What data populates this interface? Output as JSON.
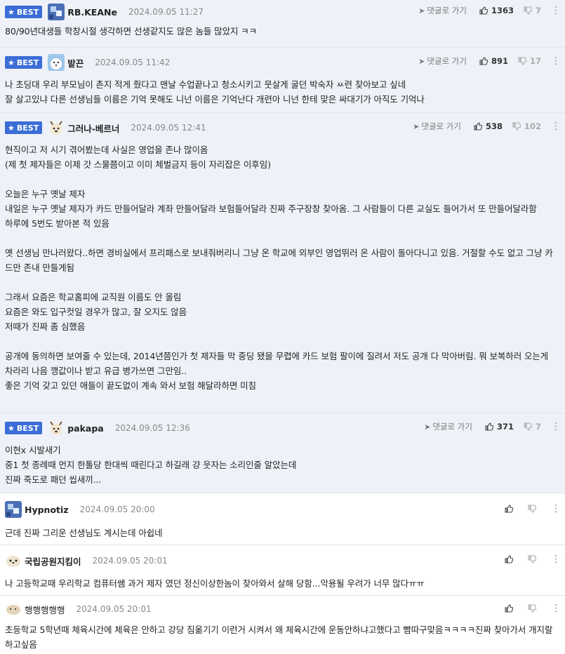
{
  "labels": {
    "best": "BEST",
    "reply": "댓글로 가기"
  },
  "colors": {
    "best_badge": "#3b6dd6",
    "best_row_bg": "#eef2f8"
  },
  "comments": [
    {
      "best": true,
      "nick": "RB.KEANe",
      "avatar": "blue-pixel-avatar",
      "date": "2024.09.05 11:27",
      "up": "1363",
      "down": "7",
      "body": "80/90년대생들 학창시절 생각하면 선생같지도 않은 놈들 많았지 ㅋㅋ"
    },
    {
      "best": true,
      "nick": "밭끈",
      "avatar": "white-bear-avatar",
      "date": "2024.09.05 11:42",
      "up": "891",
      "down": "17",
      "body": "나 초딩대 우리 부모님이 촌지 적게 줬다고 맨날 수업끝나고 청소시키고 뭇살게 굴던 박숙자 ㅆ련 찾아보고 싶네\n잘 살고있냐 다른 선생님들 이름은 기억 못해도 니넌 이름은 기억난다 개련아 니넌 한테 맞은 싸대기가 아직도 기억나"
    },
    {
      "best": true,
      "nick": "그러나-베르너",
      "avatar": "dog-avatar",
      "date": "2024.09.05 12:41",
      "up": "538",
      "down": "102",
      "body": "현직이고 저 시기 겪어봤는데 사실은 영업을 존나 많이옴\n(제 첫 제자들은 이제 갓 스물쯤이고 이미 체벌금지 등이 자리잡은 이후임)\n\n오늘은 누구 옛날 제자\n내일은 누구 옛날 제자가 카드 만들어달라 계좌 만들어달라 보험들어달라 진짜 주구장창 찾아옴. 그 사람들이 다른 교실도 들어가서 또 만들어달라함\n하루에 5번도 받아본 적 있음\n\n옛 선생님 만나러왔다..하면 경비실에서 프리패스로 보내줘버리니 그냥 온 학교에 외부인 영업뛰러 온 사람이 돌아다니고 있음. 거절할 수도 없고 그냥 카드만 존내 만들게됨\n\n그래서 요즘은 학교홈피에 교직원 이름도 안 올림\n요즘은 와도 입구컷일 경우가 많고, 잘 오지도 않음\n저때가 진짜 좀 심했음\n\n공개에 동의하면 보여줄 수 있는데, 2014년쯤인가 첫 제자들 막 중딩 됐을 무렵에 카드 보험 팔이에 질려서 저도 공개 다 막아버림. 뭐 보복하러 오는게 차라리 나음 깽값이나 받고 유급 병가쓰면 그만임..\n좋은 기억 갖고 있던 애들이 끝도없이 계속 와서 보험 해달라하면 미침"
    },
    {
      "best": true,
      "nick": "pakapa",
      "avatar": "dog-avatar",
      "date": "2024.09.05 12:36",
      "up": "371",
      "down": "7",
      "body": "이현x 시발새기\n중1 첫 종례때 먼지 한톨당 한대씩 때린다고 하길래 걍 웃자는 소리인줄 알았는데\n진짜 죽도로 패던 씹새끼..."
    },
    {
      "best": false,
      "nick": "Hypnotiz",
      "avatar": "blue-pixel-avatar",
      "date": "2024.09.05 20:00",
      "up": "",
      "down": "",
      "body": "근데 진짜 그리운 선생님도 계시는데 아쉽네"
    },
    {
      "best": false,
      "nick": "국립공원지킴이",
      "avatar": "seal-avatar",
      "date": "2024.09.05 20:01",
      "up": "",
      "down": "",
      "body": "나 고등학교때 우리학교 컴퓨터쌤 과거 제자 였던 정신이상한놈이 찾아와서 살해 당함...악용될 우려가 너무 많다ㅠㅠ"
    },
    {
      "best": false,
      "nick": "행행행행행",
      "avatar": "potato-avatar",
      "date": "2024.09.05 20:01",
      "up": "",
      "down": "",
      "body": "초등학교 5학년때 체육시간에 체육은 안하고 강당 짐옮기기 이런거 시켜서 왜 체육시간에 운동안하냐고했다고 빰따구맞음ㅋㅋㅋㅋ진짜 찾아가서 개지랄하고싶음"
    }
  ]
}
